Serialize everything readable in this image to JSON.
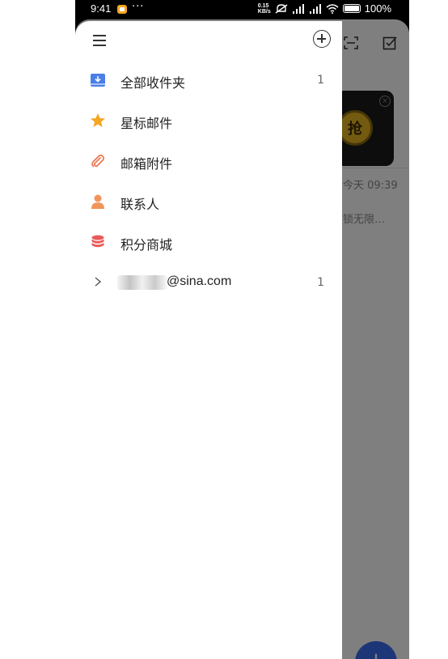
{
  "status_bar": {
    "time": "9:41",
    "dots": "···",
    "net_speed_value": "0.15",
    "net_speed_unit": "KB/s",
    "battery_percent": "100%"
  },
  "drawer": {
    "items": [
      {
        "label": "全部收件夹",
        "count": "1",
        "icon": "inbox-download-icon",
        "color": "#4a7fe8"
      },
      {
        "label": "星标邮件",
        "count": "",
        "icon": "star-icon",
        "color": "#f5a623"
      },
      {
        "label": "邮箱附件",
        "count": "",
        "icon": "paperclip-icon",
        "color": "#e8734a"
      },
      {
        "label": "联系人",
        "count": "",
        "icon": "person-icon",
        "color": "#f0955a"
      },
      {
        "label": "积分商城",
        "count": "",
        "icon": "coins-stack-icon",
        "color": "#e85a5a"
      }
    ],
    "account": {
      "email": "@sina.com",
      "count": "1"
    }
  },
  "background_app": {
    "mail_time": "今天 09:39",
    "mail_preview": "锁无限…",
    "ad_badge": "抢",
    "ad_close": "×",
    "fab": "+"
  }
}
